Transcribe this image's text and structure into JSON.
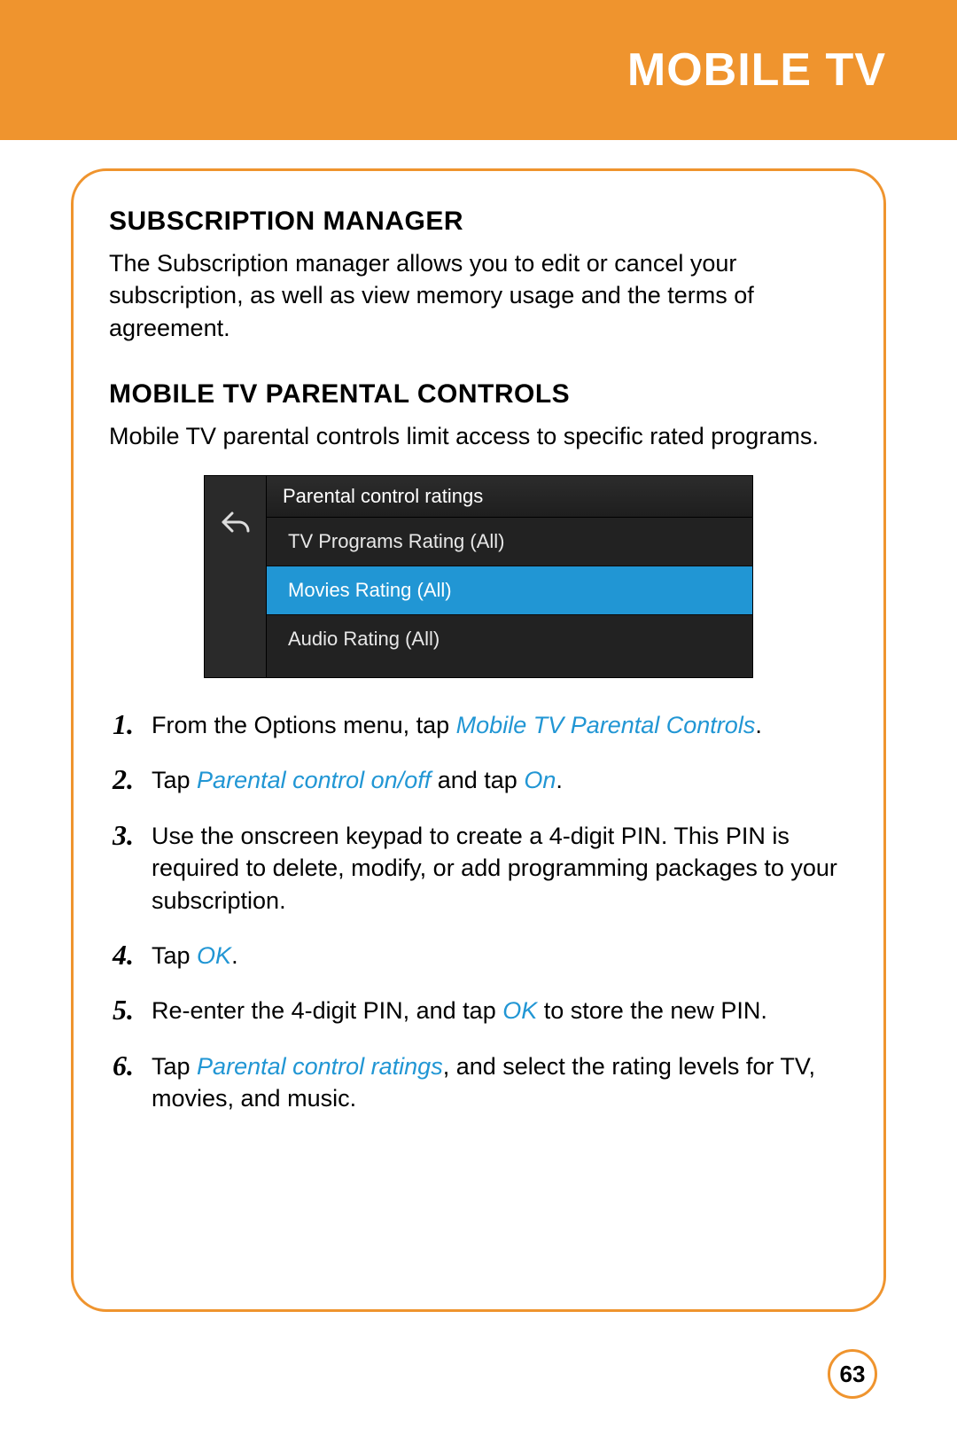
{
  "header": {
    "title": "MOBILE TV"
  },
  "sections": {
    "sub_manager": {
      "heading": "SUBSCRIPTION MANAGER",
      "text": "The Subscription manager allows you to edit or cancel your subscription, as well as view memory usage and the terms of agreement."
    },
    "parental": {
      "heading": "MOBILE TV PARENTAL CONTROLS",
      "text": "Mobile TV parental controls limit access to specific rated programs."
    }
  },
  "screenshot": {
    "header": "Parental control ratings",
    "items": [
      "TV Programs Rating (All)",
      "Movies Rating (All)",
      "Audio Rating (All)"
    ],
    "selected_index": 1
  },
  "steps": {
    "s1_a": "From the Options menu, tap ",
    "s1_hl": "Mobile TV Parental Controls",
    "s1_b": ".",
    "s2_a": "Tap ",
    "s2_hl1": "Parental control on/off",
    "s2_mid": " and tap ",
    "s2_hl2": "On",
    "s2_b": ".",
    "s3": "Use the onscreen keypad to create a 4-digit PIN. This PIN is required to delete, modify, or add programming packages to your subscription.",
    "s4_a": "Tap ",
    "s4_hl": "OK",
    "s4_b": ".",
    "s5_a": "Re-enter the 4-digit PIN, and tap ",
    "s5_hl": "OK",
    "s5_b": " to store the new PIN.",
    "s6_a": "Tap ",
    "s6_hl": "Parental control ratings",
    "s6_b": ", and select the rating levels for TV, movies, and music."
  },
  "page_number": "63"
}
